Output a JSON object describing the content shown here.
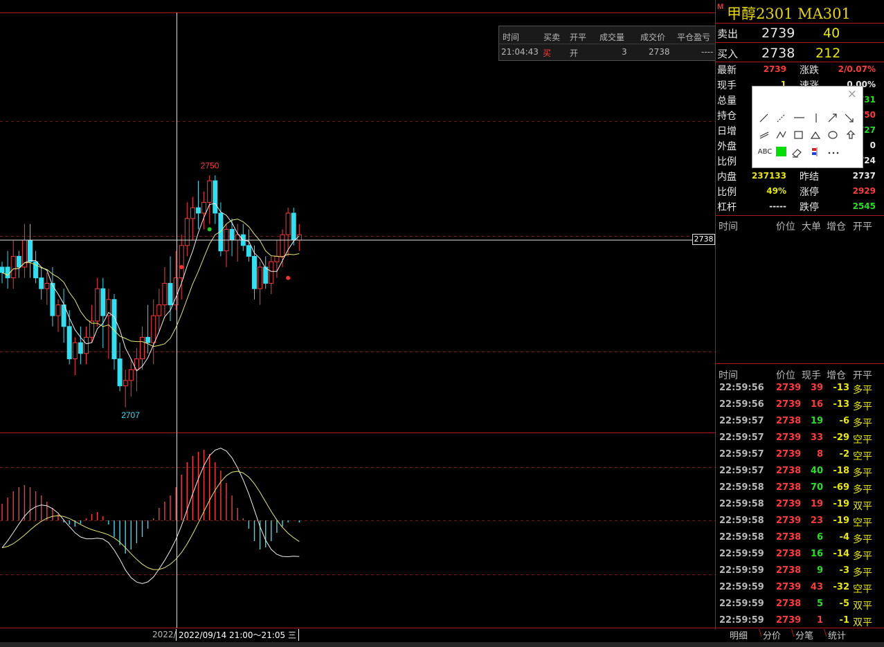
{
  "title": {
    "marker": "M",
    "text": "甲醇2301  MA301"
  },
  "quote": {
    "sell": {
      "label": "卖出",
      "price": "2739",
      "volume": "40"
    },
    "buy": {
      "label": "买入",
      "price": "2738",
      "volume": "212"
    },
    "rows": [
      {
        "l1": "最新",
        "v1": "2739",
        "l2": "涨跌",
        "v2": "2/0.07%"
      },
      {
        "l1": "现手",
        "v1": "1",
        "l2": "速涨",
        "v2": "0.00%"
      },
      {
        "l1": "总量",
        "v1": "",
        "l2": "",
        "v2": "731"
      },
      {
        "l1": "持仓",
        "v1": "",
        "l2": "",
        "v2": "750"
      },
      {
        "l1": "日增",
        "v1": "",
        "l2": "",
        "v2": "727"
      },
      {
        "l1": "外盘",
        "v1": "",
        "l2": "",
        "v2": "0"
      },
      {
        "l1": "比例",
        "v1": "",
        "l2": "",
        "v2": "724"
      },
      {
        "l1": "内盘",
        "v1": "237133",
        "l2": "昨结",
        "v2": "2737"
      },
      {
        "l1": "比例",
        "v1": "49%",
        "l2": "涨停",
        "v2": "2929"
      },
      {
        "l1": "杠杆",
        "v1": "-----",
        "l2": "跌停",
        "v2": "2545"
      }
    ]
  },
  "bigorder_header": {
    "time": "时间",
    "price": "价位",
    "big": "大单",
    "oi": "增仓",
    "oc": "开平"
  },
  "ticks_header": {
    "time": "时间",
    "price": "价位",
    "hand": "现手",
    "oi": "增仓",
    "oc": "开平"
  },
  "ticks": [
    {
      "time": "22:59:56",
      "price": "2739",
      "hand": "39",
      "oi": "-13",
      "oc": "多平"
    },
    {
      "time": "22:59:56",
      "price": "2739",
      "hand": "16",
      "oi": "-13",
      "oc": "多平"
    },
    {
      "time": "22:59:57",
      "price": "2738",
      "hand": "19",
      "oi": "-6",
      "oc": "多平"
    },
    {
      "time": "22:59:57",
      "price": "2739",
      "hand": "33",
      "oi": "-29",
      "oc": "空平"
    },
    {
      "time": "22:59:57",
      "price": "2739",
      "hand": "8",
      "oi": "-2",
      "oc": "空平"
    },
    {
      "time": "22:59:57",
      "price": "2738",
      "hand": "40",
      "oi": "-18",
      "oc": "多平"
    },
    {
      "time": "22:59:58",
      "price": "2738",
      "hand": "70",
      "oi": "-69",
      "oc": "多平"
    },
    {
      "time": "22:59:58",
      "price": "2739",
      "hand": "19",
      "oi": "-19",
      "oc": "双平"
    },
    {
      "time": "22:59:58",
      "price": "2739",
      "hand": "23",
      "oi": "-19",
      "oc": "空平"
    },
    {
      "time": "22:59:58",
      "price": "2738",
      "hand": "6",
      "oi": "-4",
      "oc": "多平"
    },
    {
      "time": "22:59:59",
      "price": "2738",
      "hand": "16",
      "oi": "-14",
      "oc": "多平"
    },
    {
      "time": "22:59:59",
      "price": "2738",
      "hand": "9",
      "oi": "-3",
      "oc": "多平"
    },
    {
      "time": "22:59:59",
      "price": "2739",
      "hand": "43",
      "oi": "-32",
      "oc": "空平"
    },
    {
      "time": "22:59:59",
      "price": "2738",
      "hand": "5",
      "oi": "-5",
      "oc": "双平"
    },
    {
      "time": "22:59:59",
      "price": "2739",
      "hand": "1",
      "oi": "-1",
      "oc": "双平"
    }
  ],
  "trade_box": {
    "headers": [
      "时间",
      "买卖",
      "开平",
      "成交量",
      "成交价",
      "平仓盈亏"
    ],
    "row": [
      "21:04:43",
      "买",
      "开",
      "3",
      "2738",
      "----"
    ]
  },
  "tabs": [
    "明细",
    "分价",
    "分笔",
    "统计"
  ],
  "date_bar": {
    "prefix": "2022/",
    "range": "2022/09/14 21:00～21:05 三"
  },
  "chart_labels": {
    "high": "2750",
    "low": "2707",
    "cursor_price": "2738"
  },
  "toolbox": {
    "close": "×",
    "text_tool": "ABC",
    "icons": [
      "line-icon",
      "dashed-line-icon",
      "horizontal-line-icon",
      "vertical-line-icon",
      "arrow-up-right-icon",
      "arrow-down-right-icon",
      "parallel-lines-icon",
      "polyline-icon",
      "rectangle-icon",
      "triangle-icon",
      "ellipse-icon",
      "up-arrow-icon",
      "text-tool-icon",
      "color-swatch-icon",
      "eraser-icon",
      "flag-icon",
      "more-icon"
    ],
    "swatch_color": "#00e000"
  },
  "colors": {
    "up": "#ff3a3a",
    "down": "#30e0f0",
    "border": "#b01818",
    "ma_white": "#f0f0f0",
    "ma_yellow": "#e8e870"
  },
  "chart_data": {
    "type": "candlestick",
    "high_label": 2750,
    "low_label": 2707,
    "cursor_price": 2738,
    "candles": [
      [
        2733,
        2734,
        2730,
        2732
      ],
      [
        2733,
        2736,
        2729,
        2731
      ],
      [
        2731,
        2738,
        2729,
        2735
      ],
      [
        2735,
        2736,
        2731,
        2733
      ],
      [
        2733,
        2741,
        2731,
        2738
      ],
      [
        2738,
        2741,
        2731,
        2734
      ],
      [
        2734,
        2736,
        2730,
        2731
      ],
      [
        2731,
        2733,
        2727,
        2729
      ],
      [
        2729,
        2732,
        2726,
        2730
      ],
      [
        2730,
        2733,
        2722,
        2724
      ],
      [
        2724,
        2727,
        2721,
        2726
      ],
      [
        2726,
        2729,
        2719,
        2722
      ],
      [
        2722,
        2725,
        2715,
        2716
      ],
      [
        2716,
        2720,
        2713,
        2719
      ],
      [
        2719,
        2722,
        2715,
        2717
      ],
      [
        2717,
        2722,
        2715,
        2720
      ],
      [
        2720,
        2726,
        2719,
        2723
      ],
      [
        2723,
        2731,
        2722,
        2729
      ],
      [
        2729,
        2731,
        2718,
        2724
      ],
      [
        2724,
        2729,
        2716,
        2727
      ],
      [
        2727,
        2728,
        2714,
        2716
      ],
      [
        2716,
        2719,
        2710,
        2711
      ],
      [
        2711,
        2714,
        2707,
        2712
      ],
      [
        2712,
        2716,
        2709,
        2714
      ],
      [
        2714,
        2718,
        2710,
        2716
      ],
      [
        2716,
        2722,
        2714,
        2720
      ],
      [
        2720,
        2726,
        2717,
        2719
      ],
      [
        2719,
        2727,
        2715,
        2724
      ],
      [
        2724,
        2729,
        2721,
        2726
      ],
      [
        2726,
        2733,
        2724,
        2730
      ],
      [
        2730,
        2735,
        2723,
        2726
      ],
      [
        2726,
        2736,
        2725,
        2731
      ],
      [
        2731,
        2739,
        2727,
        2737
      ],
      [
        2737,
        2745,
        2735,
        2742
      ],
      [
        2742,
        2746,
        2738,
        2744
      ],
      [
        2744,
        2749,
        2740,
        2743
      ],
      [
        2743,
        2747,
        2740,
        2745
      ],
      [
        2745,
        2750,
        2741,
        2749
      ],
      [
        2749,
        2750,
        2741,
        2743
      ],
      [
        2743,
        2745,
        2735,
        2736
      ],
      [
        2736,
        2741,
        2733,
        2740
      ],
      [
        2740,
        2742,
        2735,
        2738
      ],
      [
        2738,
        2741,
        2734,
        2739
      ],
      [
        2739,
        2741,
        2736,
        2737
      ],
      [
        2737,
        2740,
        2734,
        2735
      ],
      [
        2735,
        2737,
        2727,
        2729
      ],
      [
        2729,
        2734,
        2726,
        2733
      ],
      [
        2733,
        2735,
        2729,
        2730
      ],
      [
        2730,
        2735,
        2728,
        2734
      ],
      [
        2734,
        2738,
        2731,
        2735
      ],
      [
        2735,
        2740,
        2733,
        2739
      ],
      [
        2739,
        2744,
        2735,
        2743
      ],
      [
        2743,
        2744,
        2737,
        2738
      ],
      [
        2738,
        2741,
        2736,
        2739
      ]
    ],
    "macd_hist": [
      0.4,
      0.55,
      0.7,
      0.8,
      0.85,
      0.8,
      0.7,
      0.6,
      0.45,
      0.3,
      0.15,
      -0.05,
      -0.1,
      -0.15,
      -0.08,
      0.05,
      0.15,
      0.2,
      0.1,
      -0.1,
      -0.4,
      -0.6,
      -0.8,
      -0.7,
      -0.55,
      -0.4,
      -0.2,
      0.05,
      0.3,
      0.45,
      0.6,
      0.8,
      1.1,
      1.4,
      1.55,
      1.65,
      1.7,
      1.6,
      1.4,
      1.2,
      0.9,
      0.6,
      0.3,
      0.05,
      -0.2,
      -0.5,
      -0.7,
      -0.65,
      -0.5,
      -0.3,
      -0.15,
      -0.05,
      0.0,
      -0.05
    ]
  }
}
